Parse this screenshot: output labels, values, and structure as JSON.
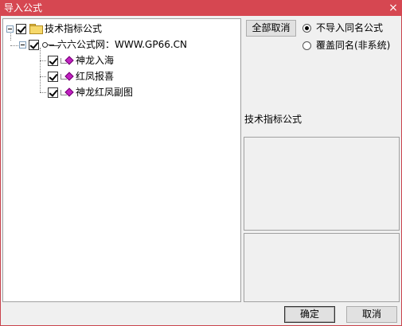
{
  "window": {
    "title": "导入公式",
    "close_glyph": "×"
  },
  "tree": {
    "root": {
      "label": "技术指标公式",
      "checked": true,
      "expanded": true,
      "icon": "folder-icon"
    },
    "group": {
      "label": "六六公式网：WWW.GP66.CN",
      "checked": true,
      "expanded": true,
      "icon": "key-icon"
    },
    "items": [
      {
        "label": "神龙入海",
        "checked": true,
        "icon": "formula-icon"
      },
      {
        "label": "红凤报喜",
        "checked": true,
        "icon": "formula-icon"
      },
      {
        "label": "神龙红凤副图",
        "checked": true,
        "icon": "formula-icon"
      }
    ]
  },
  "options": {
    "select_toggle_label": "全部取消",
    "radio_skip_label": "不导入同名公式",
    "radio_overwrite_label": "覆盖同名(非系统)",
    "selected": "radio_skip"
  },
  "info": {
    "category_label": "技术指标公式"
  },
  "footer": {
    "ok_label": "确定",
    "cancel_label": "取消"
  },
  "colors": {
    "titlebar": "#d64751",
    "formula_icon": "#c020c0"
  }
}
